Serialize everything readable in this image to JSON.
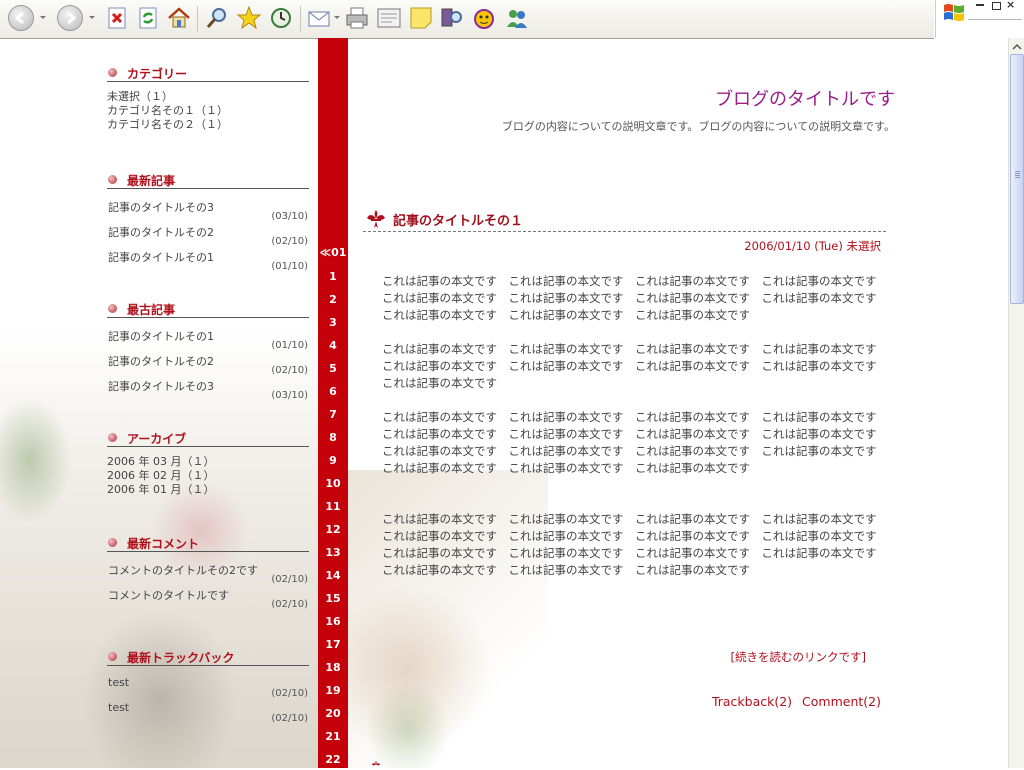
{
  "sidebar": {
    "categories": {
      "title": "カテゴリー",
      "items": [
        "未選択（１）",
        "カテゴリ名その１（１）",
        "カテゴリ名その２（１）"
      ]
    },
    "recent_posts": {
      "title": "最新記事",
      "items": [
        {
          "title": "記事のタイトルその3",
          "date": "(03/10)"
        },
        {
          "title": "記事のタイトルその2",
          "date": "(02/10)"
        },
        {
          "title": "記事のタイトルその1",
          "date": "(01/10)"
        }
      ]
    },
    "oldest_posts": {
      "title": "最古記事",
      "items": [
        {
          "title": "記事のタイトルその1",
          "date": "(01/10)"
        },
        {
          "title": "記事のタイトルその2",
          "date": "(02/10)"
        },
        {
          "title": "記事のタイトルその3",
          "date": "(03/10)"
        }
      ]
    },
    "archive": {
      "title": "アーカイブ",
      "items": [
        "2006 年 03 月（１）",
        "2006 年 02 月（１）",
        "2006 年 01 月（１）"
      ]
    },
    "recent_comments": {
      "title": "最新コメント",
      "items": [
        {
          "title": "コメントのタイトルその2です",
          "date": "(02/10)"
        },
        {
          "title": "コメントのタイトルです",
          "date": "(02/10)"
        }
      ]
    },
    "recent_trackbacks": {
      "title": "最新トラックバック",
      "items": [
        {
          "title": "test",
          "date": "(02/10)"
        },
        {
          "title": "test",
          "date": "(02/10)"
        }
      ]
    }
  },
  "calendar": {
    "prev_label": "≪01",
    "days": [
      "1",
      "2",
      "3",
      "4",
      "5",
      "6",
      "7",
      "8",
      "9",
      "10",
      "11",
      "12",
      "13",
      "14",
      "15",
      "16",
      "17",
      "18",
      "19",
      "20",
      "21",
      "22"
    ]
  },
  "blog": {
    "title": "ブログのタイトルです",
    "description": "ブログの内容についての説明文章です。ブログの内容についての説明文章です。"
  },
  "post": {
    "title": "記事のタイトルその１",
    "meta": "2006/01/10 (Tue)  未選択",
    "body": [
      "これは記事の本文です　これは記事の本文です　これは記事の本文です　これは記事の本文です",
      "これは記事の本文です　これは記事の本文です　これは記事の本文です　これは記事の本文です",
      "これは記事の本文です　これは記事の本文です　これは記事の本文です",
      "",
      "これは記事の本文です　これは記事の本文です　これは記事の本文です　これは記事の本文です",
      "これは記事の本文です　これは記事の本文です　これは記事の本文です　これは記事の本文です",
      "これは記事の本文です",
      "",
      "これは記事の本文です　これは記事の本文です　これは記事の本文です　これは記事の本文です",
      "これは記事の本文です　これは記事の本文です　これは記事の本文です　これは記事の本文です",
      "これは記事の本文です　これは記事の本文です　これは記事の本文です　これは記事の本文です",
      "これは記事の本文です　これは記事の本文です　これは記事の本文です",
      "",
      "",
      "これは記事の本文です　これは記事の本文です　これは記事の本文です　これは記事の本文です",
      "これは記事の本文です　これは記事の本文です　これは記事の本文です　これは記事の本文です",
      "これは記事の本文です　これは記事の本文です　これは記事の本文です　これは記事の本文です",
      "これは記事の本文です　これは記事の本文です　これは記事の本文です"
    ],
    "read_more": "[続きを読むのリンクです]",
    "trackback": "Trackback(2)",
    "comment": "Comment(2)"
  },
  "toolbar": {
    "icons": [
      "back-icon",
      "forward-icon",
      "stop-icon",
      "refresh-icon",
      "home-icon",
      "search-icon",
      "favorites-icon",
      "history-icon",
      "mail-icon",
      "print-icon",
      "edit-icon",
      "notes-icon",
      "research-icon",
      "messenger-icon",
      "contacts-icon"
    ]
  },
  "colors": {
    "accent_red": "#c4000a",
    "title_purple": "#9a1d8a",
    "link_red": "#b0101c"
  }
}
